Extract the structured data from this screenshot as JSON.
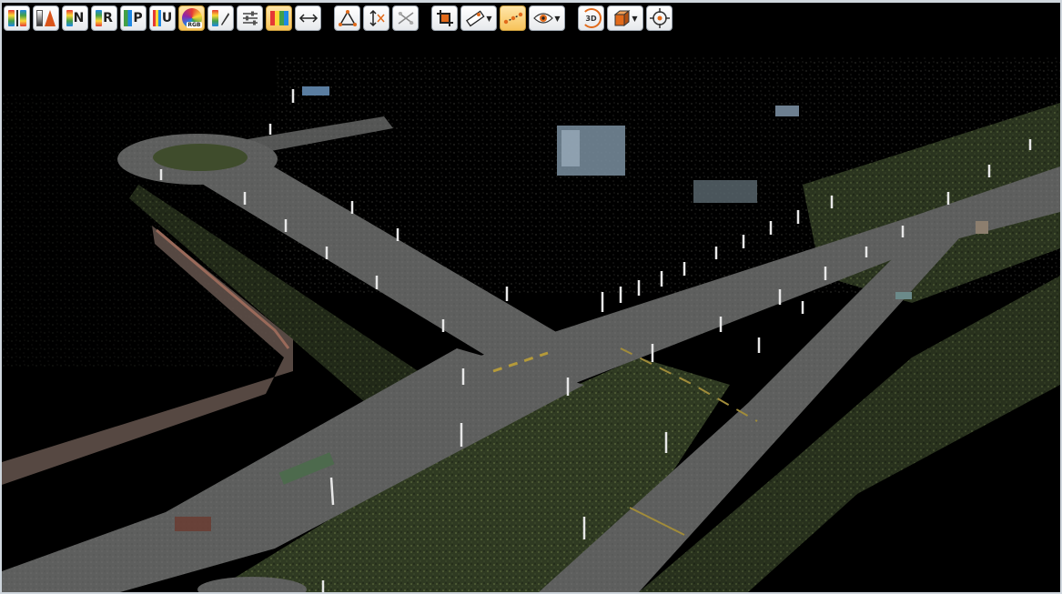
{
  "toolbar": {
    "items": [
      {
        "name": "colormap-elevation-button",
        "icon": "elevation-color-ramp-icon"
      },
      {
        "name": "colormap-gray-button",
        "icon": "intensity-ramp-icon"
      },
      {
        "name": "colormap-n-button",
        "icon": "normal-color-icon",
        "letter": "N"
      },
      {
        "name": "colormap-r-button",
        "icon": "return-color-icon",
        "letter": "R"
      },
      {
        "name": "colormap-p-button",
        "icon": "point-source-color-icon",
        "letter": "P"
      },
      {
        "name": "colormap-u-button",
        "icon": "user-data-color-icon",
        "letter": "U"
      },
      {
        "name": "colormap-rgb-button",
        "icon": "rgb-color-icon",
        "label": "RGB",
        "active": true
      },
      {
        "name": "edit-colormap-button",
        "icon": "pencil-ramp-icon"
      },
      {
        "name": "settings-sliders-button",
        "icon": "sliders-icon"
      },
      {
        "name": "classification-button",
        "icon": "class-palette-icon",
        "active": true
      },
      {
        "name": "measure-distance-button",
        "icon": "distance-arrow-icon"
      },
      {
        "name": "measure-angle-button",
        "icon": "angle-measure-icon"
      },
      {
        "name": "measure-height-button",
        "icon": "height-measure-icon"
      },
      {
        "name": "remove-measurements-button",
        "icon": "remove-measure-icon"
      },
      {
        "name": "clip-box-button",
        "icon": "crop-icon"
      },
      {
        "name": "profile-tool-button",
        "icon": "ruler-icon",
        "dropdown": true
      },
      {
        "name": "point-snap-button",
        "icon": "point-link-icon",
        "active": true
      },
      {
        "name": "view-mode-button",
        "icon": "eye-icon",
        "dropdown": true
      },
      {
        "name": "rotate-3d-button",
        "icon": "rotate-3d-icon",
        "label": "3D"
      },
      {
        "name": "view-cube-button",
        "icon": "cube-icon",
        "dropdown": true
      },
      {
        "name": "center-target-button",
        "icon": "target-icon"
      }
    ]
  },
  "colors": {
    "toolbar_bg": "#e7e9ec",
    "active_bg": "#f7c35a",
    "road": "#5c5d5c",
    "grass": "#3d4a2a",
    "background": "#000000"
  }
}
